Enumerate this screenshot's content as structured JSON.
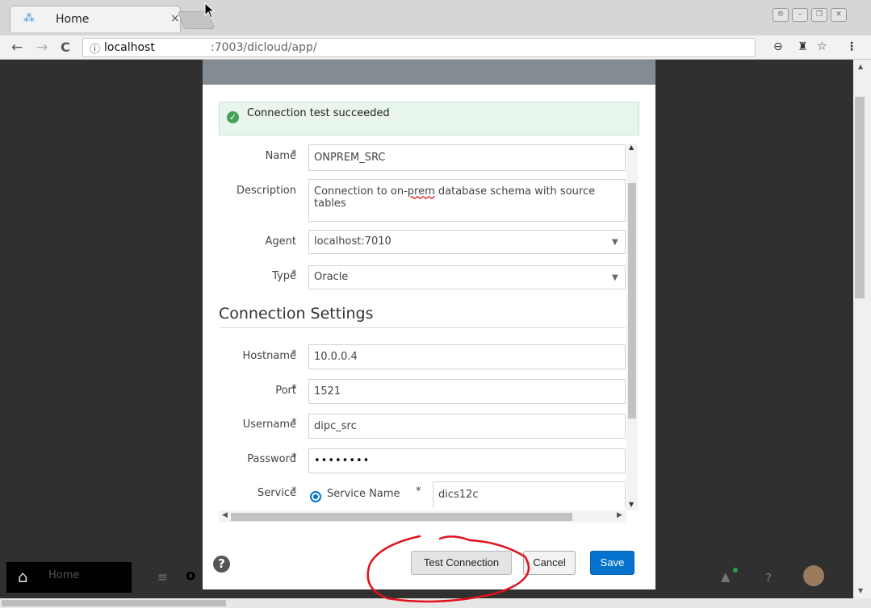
{
  "browser": {
    "tab_title": "Home",
    "tab_close": "×",
    "url_host": "localhost",
    "url_rest": ":7003/dicloud/app/",
    "win_controls": [
      "⦾",
      "–",
      "❐",
      "✕"
    ]
  },
  "banner": {
    "text": "Connection test succeeded"
  },
  "form": {
    "name_label": "Name",
    "name_value": "ONPREM_SRC",
    "description_label": "Description",
    "description_value_before": "Connection to on-",
    "description_value_misspelled": "prem",
    "description_value_after": " database schema with source tables",
    "agent_label": "Agent",
    "agent_value": "localhost:7010",
    "type_label": "Type",
    "type_value": "Oracle",
    "required_mark": "*"
  },
  "settings": {
    "title": "Connection Settings",
    "hostname_label": "Hostname",
    "hostname_value": "10.0.0.4",
    "port_label": "Port",
    "port_value": "1521",
    "username_label": "Username",
    "username_value": "dipc_src",
    "password_label": "Password",
    "password_value": "••••••••",
    "service_label": "Service",
    "service_option": "Service Name",
    "service_value": "dics12c"
  },
  "footer": {
    "help": "?",
    "test_button": "Test Connection",
    "cancel_button": "Cancel",
    "save_button": "Save"
  },
  "background": {
    "home_label": "Home"
  },
  "colors": {
    "primary": "#0572ce",
    "success": "#47a15a",
    "annotation": "#e0121c"
  }
}
